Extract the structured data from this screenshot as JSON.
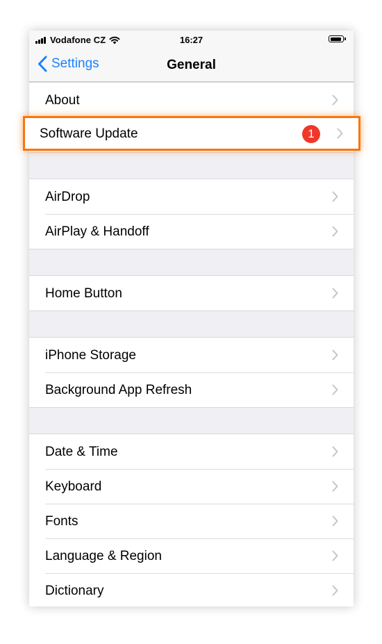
{
  "status_bar": {
    "carrier": "Vodafone CZ",
    "time": "16:27"
  },
  "nav": {
    "back_label": "Settings",
    "title": "General"
  },
  "groups": [
    {
      "items": [
        {
          "label": "About"
        }
      ]
    },
    {
      "items": [
        {
          "label": "AirDrop"
        },
        {
          "label": "AirPlay & Handoff"
        }
      ]
    },
    {
      "items": [
        {
          "label": "Home Button"
        }
      ]
    },
    {
      "items": [
        {
          "label": "iPhone Storage"
        },
        {
          "label": "Background App Refresh"
        }
      ]
    },
    {
      "items": [
        {
          "label": "Date & Time"
        },
        {
          "label": "Keyboard"
        },
        {
          "label": "Fonts"
        },
        {
          "label": "Language & Region"
        },
        {
          "label": "Dictionary"
        }
      ]
    }
  ],
  "highlighted_item": {
    "label": "Software Update",
    "badge": "1"
  },
  "colors": {
    "accent": "#1a82fb",
    "highlight": "#f6770f",
    "badge": "#f0382a"
  }
}
